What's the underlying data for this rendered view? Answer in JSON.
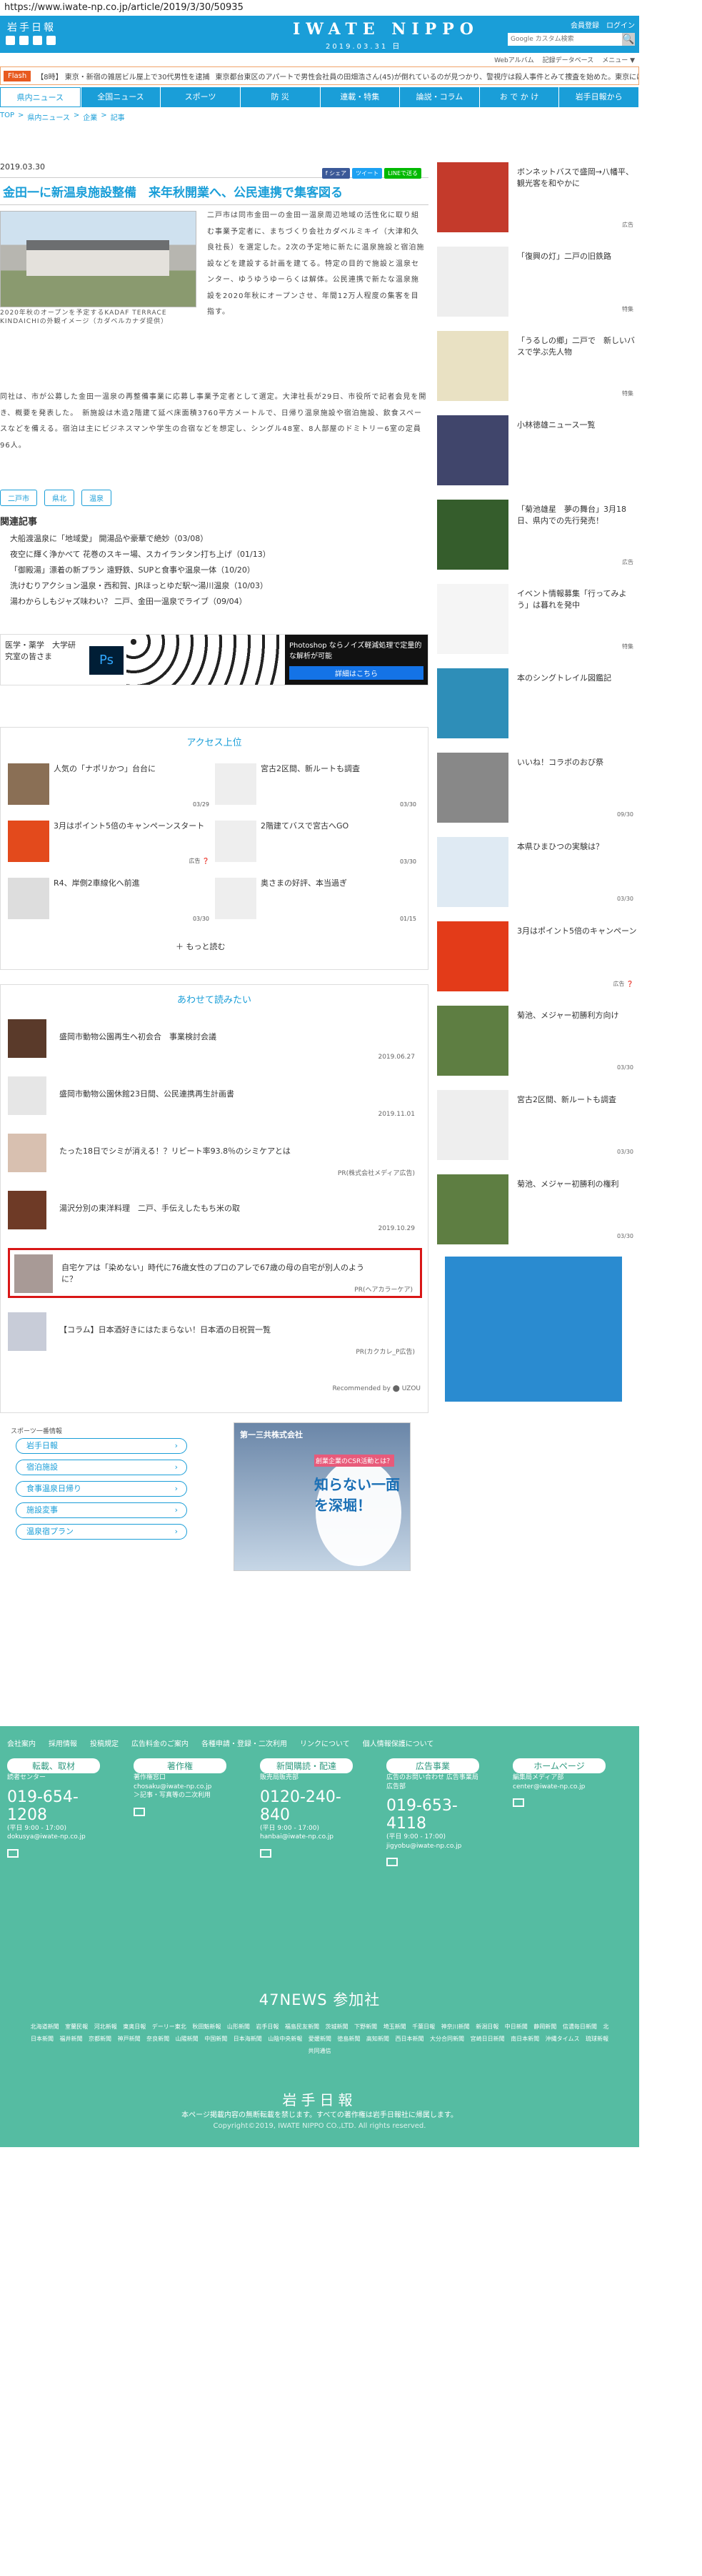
{
  "url": "https://www.iwate-np.co.jp/article/2019/3/30/50935",
  "header": {
    "logo": "岩手日報",
    "masthead": "IWATE NIPPO",
    "date": "2019.03.31 日",
    "member_link": "会員登録",
    "login_link": "ログイン",
    "search_placeholder": "Google カスタム検索",
    "sub_links": [
      "Webアルバム",
      "記録データベース",
      "メニュー ▼"
    ]
  },
  "flash": {
    "label": "Flash",
    "text1": "【8時】 東京・新宿の雑居ビル屋上で30代男性を逮捕",
    "text2": "東京都台東区のアパートで男性会社員の田畑浩さん(45)が倒れているのが見つかり、警視庁は殺人事件とみて捜査を始めた。東京にはまだ~"
  },
  "gnav": [
    "県内ニュース",
    "全国ニュース",
    "スポーツ",
    "防 災",
    "連載・特集",
    "論説・コラム",
    "お で か け",
    "岩手日報から"
  ],
  "breadcrumb": [
    "TOP",
    ">",
    "県内ニュース",
    ">",
    "企業",
    ">",
    "記事"
  ],
  "article": {
    "date": "2019.03.30",
    "share": [
      "f シェア",
      "ツイート",
      "LINEで送る"
    ],
    "title": "金田一に新温泉施設整備　来年秋開業へ、公民連携で集客図る",
    "caption": "2020年秋のオープンを予定するKADAF TERRACE KINDAICHIの外観イメージ（カダベルカナダ提供）",
    "lead": "二戸市は同市金田一の金田一温泉周辺地域の活性化に取り組む事業予定者に、まちづくり会社カダベルミキイ（大津和久良社長）を選定した。2次の予定地に新たに温泉施設と宿泊施設などを建設する計画を建てる。特定の目的で施設と温泉センター、ゆうゆうゆーらくは解体。公民連携で新たな温泉施設を2020年秋にオープンさせ、年間12万人程度の集客を目指す。",
    "body": "同社は、市が公募した金田一温泉の再整備事業に応募し事業予定者として選定。大津社長が29日、市役所で記者会見を開き、概要を発表した。　新施設は木造2階建て延べ床面積3760平方メートルで、日帰り温泉施設や宿泊施設、飲食スペースなどを備える。宿泊は主にビジネスマンや学生の合宿などを想定し、シングル48室、8人部屋のドミトリー6室の定員96人。",
    "tags": [
      "二戸市",
      "県北",
      "温泉"
    ],
    "related_heading": "関連記事",
    "related": [
      "大船渡温泉に「地域愛」 開湯品や豪華で絶妙（03/08）",
      "夜空に輝く浄かべて 花巻のスキー場、スカイランタン打ち上げ（01/13）",
      "「御殿湯」漂着の新プラン 遠野鉄、SUPと食事や温泉一体（10/20）",
      "洗けむりアクション温泉・西和賀、JRほっとゆだ駅～湯川温泉（10/03）",
      "湯わからしもジャズ味わい？ 二戸、金田一温泉でライブ（09/04）"
    ]
  },
  "ad1": {
    "left": "医学・薬学　大学研究室の皆さま",
    "ps": "Ps",
    "right": "Photoshop ならノイズ軽減処理で定量的な解析が可能",
    "button": "詳細はこちら"
  },
  "access": {
    "heading": "アクセス上位",
    "items": [
      {
        "title": "人気の「ナポリかつ」台台に",
        "date": "03/29"
      },
      {
        "title": "宮古2区間、新ルートも調査",
        "date": "03/30"
      },
      {
        "title": "3月はポイント5倍のキャンペーンスタート",
        "date": "広告 ❓"
      },
      {
        "title": "2階建てバスで宮古へGO",
        "date": "03/30"
      },
      {
        "title": "R4、岸側2車線化へ前進",
        "date": "03/30"
      },
      {
        "title": "奥さまの好評、本当過ぎ",
        "date": "01/15"
      }
    ],
    "more": "＋ もっと読む"
  },
  "recommend": {
    "heading": "あわせて読みたい",
    "items": [
      {
        "title": "盛岡市動物公園再生へ初会合　事業検討会議",
        "meta": "2019.06.27"
      },
      {
        "title": "盛岡市動物公園休館23日間、公民連携再生計画書",
        "meta": "2019.11.01"
      },
      {
        "title": "たった18日でシミが消える！？リピート率93.8％のシミケアとは",
        "meta": "PR(株式会社メディア広告)"
      },
      {
        "title": "湯沢分別の東洋料理　二戸、手伝えしたもち米の取",
        "meta": "2019.10.29"
      },
      {
        "title": "自宅ケアは「染めない」時代に76歳女性のプロのアレで67歳の母の自宅が別人のように？",
        "meta": "PR(ヘアカラーケア)"
      },
      {
        "title": "【コラム】日本酒好きにはたまらない！日本酒の日祝賀一覧",
        "meta": "PR(カクカレ_P広告)"
      }
    ],
    "powered": "Recommended by ⬤ UZOU"
  },
  "support": {
    "label": "スポーツ一番情報",
    "items": [
      "岩手日報",
      "宿泊施設",
      "食事温泉日帰り",
      "施設変事",
      "温泉宿プラン"
    ]
  },
  "ad2": {
    "company": "第一三共株式会社",
    "headline": "知らない一面を深堀！",
    "sub": "創業企業のCSR活動とは？"
  },
  "sidebar": [
    {
      "title": "ボンネットバスで盛岡→八幡平、観光客を和やかに",
      "meta": "広告"
    },
    {
      "title": "「復興の灯」二戸の旧鉄路",
      "meta": "特集"
    },
    {
      "title": "「うるしの郷」二戸で　新しいバスで学ぶ先人物",
      "meta": "特集"
    },
    {
      "title": "小林徳雄ニュース一覧",
      "meta": ""
    },
    {
      "title": "「菊池雄星　夢の舞台」3月18日、県内での先行発売！",
      "meta": "広告"
    },
    {
      "title": "イベント情報募集「行ってみよう」は暮れを発中",
      "meta": "特集"
    },
    {
      "title": "本のシングトレイル図鑑記",
      "meta": ""
    },
    {
      "title": "いいね！コラボのおび祭",
      "meta": "09/30"
    },
    {
      "title": "本県ひまひつの実験は？",
      "meta": "03/30"
    },
    {
      "title": "3月はポイント5倍のキャンペーン",
      "meta": "広告 ❓"
    },
    {
      "title": "菊池、メジャー初勝利方向け",
      "meta": "03/30"
    },
    {
      "title": "宮古2区間、新ルートも調査",
      "meta": "03/30"
    },
    {
      "title": "菊池、メジャー初勝利の権利",
      "meta": "03/30"
    }
  ],
  "footer": {
    "links": [
      "会社案内",
      "採用情報",
      "投稿規定",
      "広告料金のご案内",
      "各種申請・登録・二次利用",
      "リンクについて",
      "個人情報保護について"
    ],
    "cols": [
      {
        "head": "転載、取材",
        "label": "読者センター",
        "phone": "019-654-1208",
        "hours": "(平日 9:00 - 17:00)",
        "mail": "dokusya@iwate-np.co.jp"
      },
      {
        "head": "著作権",
        "label": "著作権窓口",
        "phone": "",
        "hours": "chosaku@iwate-np.co.jp",
        "mail": "＞記事・写真等の二次利用"
      },
      {
        "head": "新聞購読・配達",
        "label": "販売局販売部",
        "phone": "0120-240-840",
        "hours": "(平日 9:00 - 17:00)",
        "mail": "hanbai@iwate-np.co.jp"
      },
      {
        "head": "広告事業",
        "label": "広告のお問い合わせ 広告事業局広告部",
        "phone": "019-653-4118",
        "hours": "(平日 9:00 - 17:00)",
        "mail": "jigyobu@iwate-np.co.jp"
      },
      {
        "head": "ホームページ",
        "label": "編集局メディア部",
        "phone": "",
        "hours": "center@iwate-np.co.jp",
        "mail": ""
      }
    ],
    "n47": "47NEWS 参加社",
    "n47list": "北海道新聞 室蘭民報 河北新報 東奥日報 デーリー東北 秋田魁新報 山形新聞 岩手日報 福島民友新聞 茨城新聞 下野新聞 埼玉新聞 千葉日報 神奈川新聞 新潟日報 中日新聞 静岡新聞 信濃毎日新聞 北日本新聞 福井新聞 京都新聞 神戸新聞 奈良新聞 山陽新聞 中国新聞 日本海新聞 山陰中央新報 愛媛新聞 徳島新聞 高知新聞 西日本新聞 大分合同新聞 宮崎日日新聞 南日本新聞 沖縄タイムス 琉球新報 共同通信",
    "logo": "岩手日報",
    "copy1": "本ページ掲載内容の無断転載を禁じます。すべての著作権は岩手日報社に帰属します。",
    "copy2": "Copyright©2019, IWATE NIPPO CO.,LTD. All rights reserved."
  }
}
